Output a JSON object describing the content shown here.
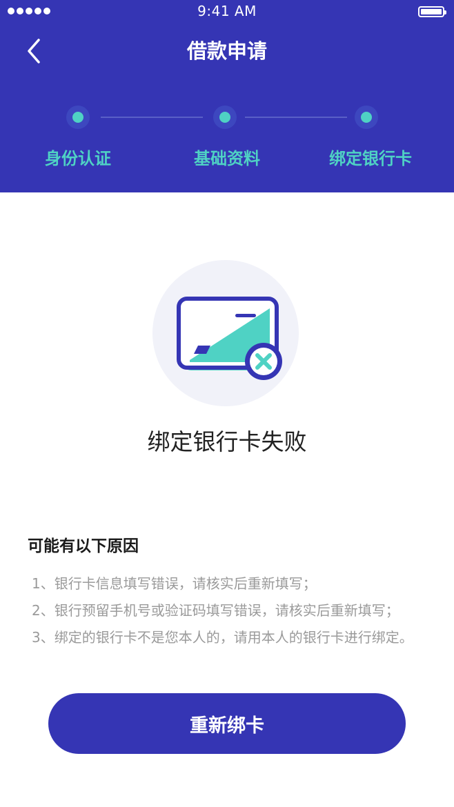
{
  "status_bar": {
    "time": "9:41 AM"
  },
  "nav": {
    "title": "借款申请"
  },
  "steps": [
    {
      "label": "身份认证"
    },
    {
      "label": "基础资料"
    },
    {
      "label": "绑定银行卡"
    }
  ],
  "result": {
    "title": "绑定银行卡失败",
    "icon": "bank-card-error-icon"
  },
  "reasons": {
    "title": "可能有以下原因",
    "items": [
      "1、银行卡信息填写错误，请核实后重新填写；",
      "2、银行预留手机号或验证码填写错误，请核实后重新填写；",
      "3、绑定的银行卡不是您本人的，请用本人的银行卡进行绑定。"
    ]
  },
  "action": {
    "retry_label": "重新绑卡"
  },
  "colors": {
    "primary": "#3535B4",
    "accent": "#4FD2C4",
    "reason_text": "#9A9A9A",
    "icon_bg": "#F1F2F9"
  }
}
